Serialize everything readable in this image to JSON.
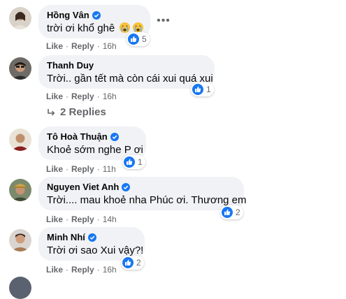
{
  "colors": {
    "bubble": "#f0f2f5",
    "secondary_text": "#65676b",
    "like_blue": "#1877f2"
  },
  "comments": [
    {
      "author": "Hồng Vân",
      "verified": true,
      "text": "trời ơi khổ ghê",
      "emojis": [
        "crying-face-emoji",
        "crying-face-emoji"
      ],
      "reaction_count": "5",
      "like_label": "Like",
      "reply_label": "Reply",
      "time": "16h"
    },
    {
      "author": "Thanh Duy",
      "verified": false,
      "text": "Trời.. gần tết mà còn cái xui quá xui",
      "reaction_count": "1",
      "like_label": "Like",
      "reply_label": "Reply",
      "time": "16h"
    },
    {
      "author": "Tô Hoà Thuận",
      "verified": true,
      "text": "Khoẻ sớm nghe P ơi",
      "reaction_count": "1",
      "like_label": "Like",
      "reply_label": "Reply",
      "time": "11h"
    },
    {
      "author": "Nguyen Viet Anh",
      "verified": true,
      "text": "Trời.... mau khoẻ nha Phúc ơi. Thương em",
      "reaction_count": "2",
      "like_label": "Like",
      "reply_label": "Reply",
      "time": "14h"
    },
    {
      "author": "Minh Nhí",
      "verified": true,
      "text": "Trời ơi sao Xui vậy?!",
      "reaction_count": "2",
      "like_label": "Like",
      "reply_label": "Reply",
      "time": "16h"
    }
  ],
  "replies_toggle": {
    "label": "2 Replies"
  },
  "more_options": {
    "icon": "more-horizontal-icon",
    "glyph": "•••"
  }
}
